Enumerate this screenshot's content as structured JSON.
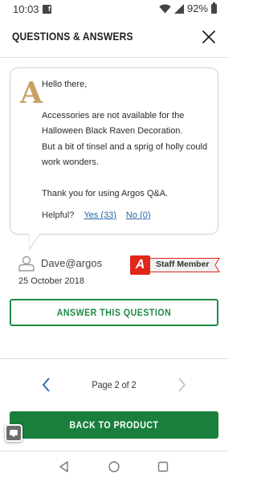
{
  "status_bar": {
    "time": "10:03",
    "notification_icon": "facebook-icon",
    "battery_percent": "92%"
  },
  "header": {
    "title": "QUESTIONS & ANSWERS",
    "close_icon": "close-icon"
  },
  "answer": {
    "badge_letter": "A",
    "text": "Hello there,\n\nAccessories are not available for the Halloween Black Raven Decoration.\nBut a bit of tinsel and a sprig of holly could work wonders.\n\nThank you for using Argos Q&A.",
    "helpful_label": "Helpful?",
    "yes_label": "Yes (33)",
    "no_label": "No (0)",
    "author": "Dave@argos",
    "date": "25 October 2018",
    "staff_logo_letter": "A",
    "staff_label": "Staff Member"
  },
  "answer_button": {
    "label": "ANSWER THIS QUESTION"
  },
  "pagination": {
    "label": "Page 2 of 2",
    "prev_icon": "chevron-left-icon",
    "next_icon": "chevron-right-icon",
    "next_enabled": false
  },
  "back_button": {
    "label": "BACK TO PRODUCT"
  },
  "colors": {
    "brand_green": "#1a7f3c",
    "argos_red": "#e1261c",
    "answer_gold": "#c7a163",
    "link_blue": "#2463a8"
  }
}
